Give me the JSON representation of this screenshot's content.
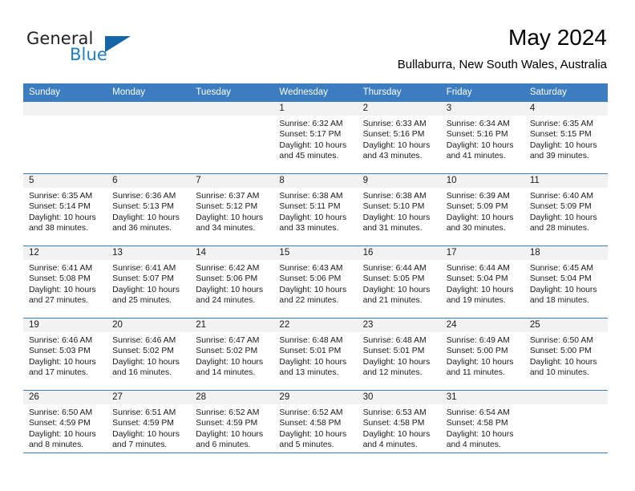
{
  "brand": {
    "name_part1": "General",
    "name_part2": "Blue"
  },
  "header": {
    "title": "May 2024",
    "subtitle": "Bullaburra, New South Wales, Australia"
  },
  "colors": {
    "header_blue": "#3b7dc0",
    "brand_blue": "#1f7fc4",
    "daynum_band": "#f2f2f2"
  },
  "weekday_headers": [
    "Sunday",
    "Monday",
    "Tuesday",
    "Wednesday",
    "Thursday",
    "Friday",
    "Saturday"
  ],
  "labels": {
    "sunrise_prefix": "Sunrise:",
    "sunset_prefix": "Sunset:",
    "daylight_prefix": "Daylight:"
  },
  "weeks": [
    [
      {
        "day": "",
        "blank": true
      },
      {
        "day": "",
        "blank": true
      },
      {
        "day": "",
        "blank": true
      },
      {
        "day": "1",
        "sunrise": "Sunrise: 6:32 AM",
        "sunset": "Sunset: 5:17 PM",
        "daylight1": "Daylight: 10 hours",
        "daylight2": "and 45 minutes."
      },
      {
        "day": "2",
        "sunrise": "Sunrise: 6:33 AM",
        "sunset": "Sunset: 5:16 PM",
        "daylight1": "Daylight: 10 hours",
        "daylight2": "and 43 minutes."
      },
      {
        "day": "3",
        "sunrise": "Sunrise: 6:34 AM",
        "sunset": "Sunset: 5:16 PM",
        "daylight1": "Daylight: 10 hours",
        "daylight2": "and 41 minutes."
      },
      {
        "day": "4",
        "sunrise": "Sunrise: 6:35 AM",
        "sunset": "Sunset: 5:15 PM",
        "daylight1": "Daylight: 10 hours",
        "daylight2": "and 39 minutes."
      }
    ],
    [
      {
        "day": "5",
        "sunrise": "Sunrise: 6:35 AM",
        "sunset": "Sunset: 5:14 PM",
        "daylight1": "Daylight: 10 hours",
        "daylight2": "and 38 minutes."
      },
      {
        "day": "6",
        "sunrise": "Sunrise: 6:36 AM",
        "sunset": "Sunset: 5:13 PM",
        "daylight1": "Daylight: 10 hours",
        "daylight2": "and 36 minutes."
      },
      {
        "day": "7",
        "sunrise": "Sunrise: 6:37 AM",
        "sunset": "Sunset: 5:12 PM",
        "daylight1": "Daylight: 10 hours",
        "daylight2": "and 34 minutes."
      },
      {
        "day": "8",
        "sunrise": "Sunrise: 6:38 AM",
        "sunset": "Sunset: 5:11 PM",
        "daylight1": "Daylight: 10 hours",
        "daylight2": "and 33 minutes."
      },
      {
        "day": "9",
        "sunrise": "Sunrise: 6:38 AM",
        "sunset": "Sunset: 5:10 PM",
        "daylight1": "Daylight: 10 hours",
        "daylight2": "and 31 minutes."
      },
      {
        "day": "10",
        "sunrise": "Sunrise: 6:39 AM",
        "sunset": "Sunset: 5:09 PM",
        "daylight1": "Daylight: 10 hours",
        "daylight2": "and 30 minutes."
      },
      {
        "day": "11",
        "sunrise": "Sunrise: 6:40 AM",
        "sunset": "Sunset: 5:09 PM",
        "daylight1": "Daylight: 10 hours",
        "daylight2": "and 28 minutes."
      }
    ],
    [
      {
        "day": "12",
        "sunrise": "Sunrise: 6:41 AM",
        "sunset": "Sunset: 5:08 PM",
        "daylight1": "Daylight: 10 hours",
        "daylight2": "and 27 minutes."
      },
      {
        "day": "13",
        "sunrise": "Sunrise: 6:41 AM",
        "sunset": "Sunset: 5:07 PM",
        "daylight1": "Daylight: 10 hours",
        "daylight2": "and 25 minutes."
      },
      {
        "day": "14",
        "sunrise": "Sunrise: 6:42 AM",
        "sunset": "Sunset: 5:06 PM",
        "daylight1": "Daylight: 10 hours",
        "daylight2": "and 24 minutes."
      },
      {
        "day": "15",
        "sunrise": "Sunrise: 6:43 AM",
        "sunset": "Sunset: 5:06 PM",
        "daylight1": "Daylight: 10 hours",
        "daylight2": "and 22 minutes."
      },
      {
        "day": "16",
        "sunrise": "Sunrise: 6:44 AM",
        "sunset": "Sunset: 5:05 PM",
        "daylight1": "Daylight: 10 hours",
        "daylight2": "and 21 minutes."
      },
      {
        "day": "17",
        "sunrise": "Sunrise: 6:44 AM",
        "sunset": "Sunset: 5:04 PM",
        "daylight1": "Daylight: 10 hours",
        "daylight2": "and 19 minutes."
      },
      {
        "day": "18",
        "sunrise": "Sunrise: 6:45 AM",
        "sunset": "Sunset: 5:04 PM",
        "daylight1": "Daylight: 10 hours",
        "daylight2": "and 18 minutes."
      }
    ],
    [
      {
        "day": "19",
        "sunrise": "Sunrise: 6:46 AM",
        "sunset": "Sunset: 5:03 PM",
        "daylight1": "Daylight: 10 hours",
        "daylight2": "and 17 minutes."
      },
      {
        "day": "20",
        "sunrise": "Sunrise: 6:46 AM",
        "sunset": "Sunset: 5:02 PM",
        "daylight1": "Daylight: 10 hours",
        "daylight2": "and 16 minutes."
      },
      {
        "day": "21",
        "sunrise": "Sunrise: 6:47 AM",
        "sunset": "Sunset: 5:02 PM",
        "daylight1": "Daylight: 10 hours",
        "daylight2": "and 14 minutes."
      },
      {
        "day": "22",
        "sunrise": "Sunrise: 6:48 AM",
        "sunset": "Sunset: 5:01 PM",
        "daylight1": "Daylight: 10 hours",
        "daylight2": "and 13 minutes."
      },
      {
        "day": "23",
        "sunrise": "Sunrise: 6:48 AM",
        "sunset": "Sunset: 5:01 PM",
        "daylight1": "Daylight: 10 hours",
        "daylight2": "and 12 minutes."
      },
      {
        "day": "24",
        "sunrise": "Sunrise: 6:49 AM",
        "sunset": "Sunset: 5:00 PM",
        "daylight1": "Daylight: 10 hours",
        "daylight2": "and 11 minutes."
      },
      {
        "day": "25",
        "sunrise": "Sunrise: 6:50 AM",
        "sunset": "Sunset: 5:00 PM",
        "daylight1": "Daylight: 10 hours",
        "daylight2": "and 10 minutes."
      }
    ],
    [
      {
        "day": "26",
        "sunrise": "Sunrise: 6:50 AM",
        "sunset": "Sunset: 4:59 PM",
        "daylight1": "Daylight: 10 hours",
        "daylight2": "and 8 minutes."
      },
      {
        "day": "27",
        "sunrise": "Sunrise: 6:51 AM",
        "sunset": "Sunset: 4:59 PM",
        "daylight1": "Daylight: 10 hours",
        "daylight2": "and 7 minutes."
      },
      {
        "day": "28",
        "sunrise": "Sunrise: 6:52 AM",
        "sunset": "Sunset: 4:59 PM",
        "daylight1": "Daylight: 10 hours",
        "daylight2": "and 6 minutes."
      },
      {
        "day": "29",
        "sunrise": "Sunrise: 6:52 AM",
        "sunset": "Sunset: 4:58 PM",
        "daylight1": "Daylight: 10 hours",
        "daylight2": "and 5 minutes."
      },
      {
        "day": "30",
        "sunrise": "Sunrise: 6:53 AM",
        "sunset": "Sunset: 4:58 PM",
        "daylight1": "Daylight: 10 hours",
        "daylight2": "and 4 minutes."
      },
      {
        "day": "31",
        "sunrise": "Sunrise: 6:54 AM",
        "sunset": "Sunset: 4:58 PM",
        "daylight1": "Daylight: 10 hours",
        "daylight2": "and 4 minutes."
      },
      {
        "day": "",
        "blank": true
      }
    ]
  ]
}
